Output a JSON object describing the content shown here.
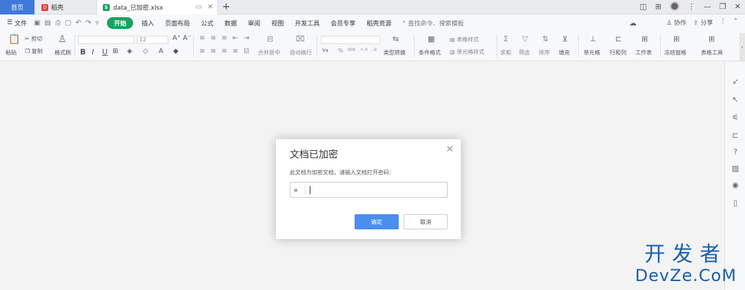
{
  "tabs": {
    "home": "首页",
    "daoke": "稻壳",
    "file": "data_已加密.xlsx",
    "add": "+"
  },
  "menu": {
    "file": "文件",
    "tabs": [
      "开始",
      "插入",
      "页面布局",
      "公式",
      "数据",
      "审阅",
      "视图",
      "开发工具",
      "会员专享",
      "稻壳资源"
    ],
    "search": "查找命令、搜索模板",
    "collaborate": "协作",
    "share": "分享"
  },
  "toolbar": {
    "paste": "粘贴",
    "cut": "剪切",
    "copy": "复制",
    "format_painter": "格式刷",
    "font_size": "12",
    "merge": "合并居中",
    "wrap": "自动换行",
    "type_convert": "类型转换",
    "cond_format": "条件格式",
    "table_style": "表格样式",
    "cell_style": "单元格样式",
    "sum": "求和",
    "filter": "筛选",
    "sort": "排序",
    "fill": "填充",
    "cell": "单元格",
    "row_col": "行和列",
    "worksheet": "工作表",
    "freeze": "冻结窗格",
    "table_tools": "表格工具",
    "percent": "%",
    "thousands": "000",
    "dec_up": "+.0",
    "dec_down": "-.0"
  },
  "dialog": {
    "title": "文档已加密",
    "prompt": "此文档为加密文档，请输入文档打开密码：",
    "password_value": "",
    "ok": "确定",
    "cancel": "取消"
  },
  "watermark": {
    "top": "开发者",
    "bottom": "DevZe.CoM"
  },
  "colors": {
    "home_tab": "#3f7ad8",
    "active_menu": "#1aa160",
    "ok_button": "#4a8ef0",
    "watermark": "#1b5fad"
  }
}
